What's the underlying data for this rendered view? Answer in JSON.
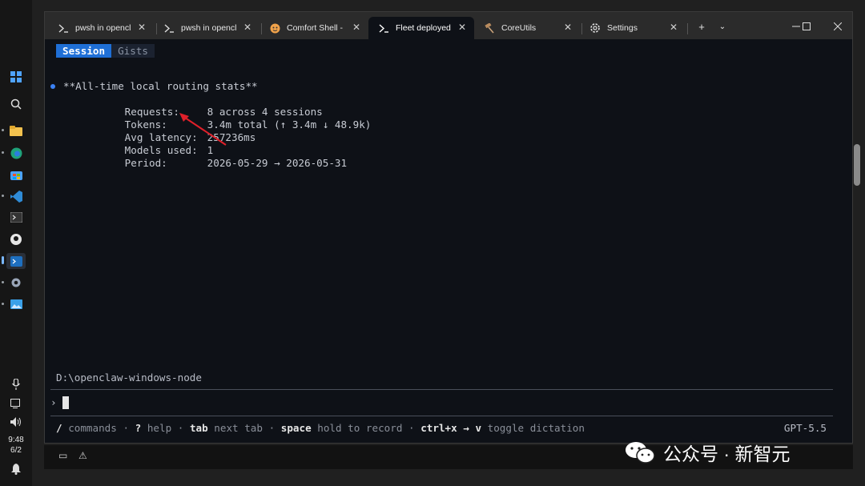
{
  "taskbar": {
    "time": "9:48",
    "date": "6/2",
    "icons": [
      "windows-icon",
      "search-icon",
      "file-explorer-icon",
      "edge-icon",
      "store-icon",
      "vscode-icon",
      "terminal-icon",
      "github-icon",
      "terminal-active-icon",
      "settings-icon",
      "photos-icon"
    ]
  },
  "window": {
    "tabs": [
      {
        "label": "pwsh in opencl",
        "icon": "powershell-icon",
        "active": false
      },
      {
        "label": "pwsh in opencl",
        "icon": "powershell-icon",
        "active": false
      },
      {
        "label": "Comfort Shell -",
        "icon": "shell-icon",
        "active": false
      },
      {
        "label": "Fleet deployed",
        "icon": "powershell-icon",
        "active": true
      },
      {
        "label": "CoreUtils",
        "icon": "hammer-icon",
        "active": false
      },
      {
        "label": "Settings",
        "icon": "gear-icon",
        "active": false
      }
    ]
  },
  "terminal": {
    "modes": {
      "session": "Session",
      "gists": "Gists"
    },
    "stats": {
      "heading": "**All-time local routing stats**",
      "rows": [
        {
          "key": "Requests:",
          "value": "8 across 4 sessions"
        },
        {
          "key": "Tokens:",
          "value": "3.4m total (↑ 3.4m ↓ 48.9k)"
        },
        {
          "key": "Avg latency:",
          "value": "257236ms"
        },
        {
          "key": "Models used:",
          "value": "1"
        },
        {
          "key": "Period:",
          "value": "2026-05-29 → 2026-05-31"
        }
      ]
    },
    "cwd": "D:\\openclaw-windows-node",
    "prompt_symbol": "›",
    "hints": {
      "slash_key": "/",
      "slash_text": "commands",
      "help_key": "?",
      "help_text": "help",
      "tab_key": "tab",
      "tab_text": "next tab",
      "space_key": "space",
      "space_text": "hold to record",
      "ctrl_key": "ctrl+x → v",
      "ctrl_text": "toggle dictation",
      "sep": "·"
    },
    "model": "GPT-5.5"
  },
  "watermark": {
    "text": "公众号 · 新智元"
  },
  "colors": {
    "accent": "#1f6fd6",
    "bullet": "#3b82f6",
    "annotation": "#e0202a"
  }
}
